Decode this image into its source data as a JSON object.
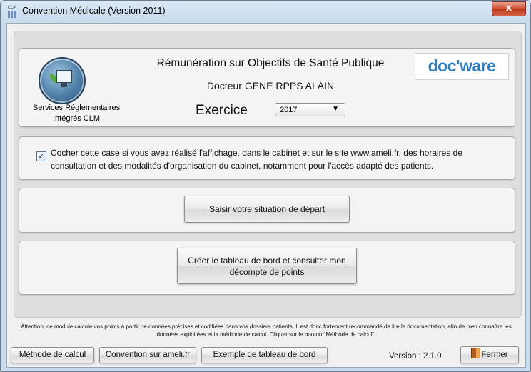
{
  "window": {
    "title": "Convention Médicale (Version 2011)",
    "app_icon_label": "CLM",
    "close_symbol": "x"
  },
  "header": {
    "clm_caption": "Services Réglementaires Intégrés CLM",
    "title": "Rémunération sur Objectifs de Santé Publique",
    "doctor": "Docteur GENE RPPS ALAIN",
    "exercice_label": "Exercice",
    "exercice_value": "2017",
    "brand_logo": "doc'ware"
  },
  "declaration": {
    "checked": true,
    "check_mark": "✓",
    "text": "Cocher cette case si vous avez réalisé l'affichage, dans le cabinet et sur le site www.ameli.fr,  des horaires de consultation et des modalités d'organisation du cabinet, notamment pour l'accès adapté des patients."
  },
  "actions": {
    "situation_button": "Saisir votre situation de départ",
    "dashboard_button": "Créer le tableau de bord et consulter mon décompte de points"
  },
  "footer": {
    "attention": "Attention, ce module calcule vos points à partir de données précises et codifiées dans vos dossiers patients. Il est donc fortement recommandé de lire la documentation, afin de bien connaître les données exploitées et la méthode de calcul. Cliquer sur le bouton \"Méthode de calcul\".",
    "methode_button": "Méthode de calcul",
    "convention_button": "Convention sur ameli.fr",
    "exemple_button": "Exemple de tableau de bord",
    "version": "Version : 2.1.0",
    "fermer_button": "Fermer"
  },
  "colors": {
    "close_button": "#c8452a",
    "brand_blue": "#2e7dbf"
  },
  "icons": [
    "app-icon",
    "clm-logo",
    "docware-logo",
    "door-exit-icon"
  ]
}
